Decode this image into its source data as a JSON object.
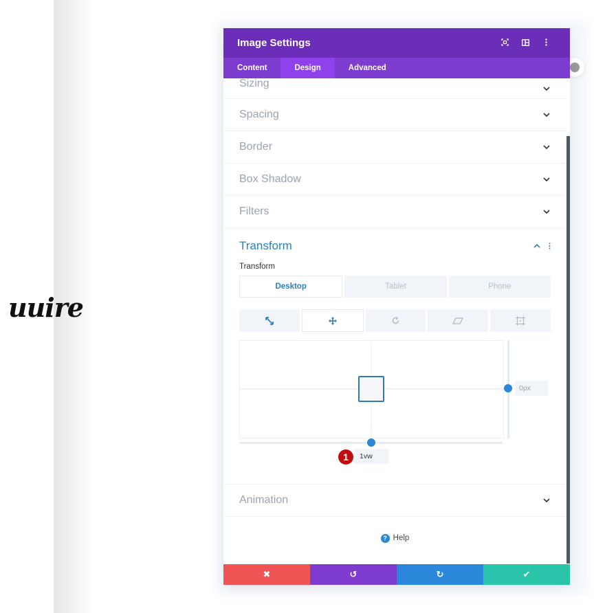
{
  "logo": {
    "text": "uuire"
  },
  "modal": {
    "title": "Image Settings",
    "header_icons": [
      "fullscreen-icon",
      "split-view-icon",
      "more-options-icon"
    ],
    "tabs": [
      {
        "label": "Content",
        "active": false
      },
      {
        "label": "Design",
        "active": true
      },
      {
        "label": "Advanced",
        "active": false
      }
    ],
    "sections": [
      {
        "label": "Sizing",
        "expanded": false
      },
      {
        "label": "Spacing",
        "expanded": false
      },
      {
        "label": "Border",
        "expanded": false
      },
      {
        "label": "Box Shadow",
        "expanded": false
      },
      {
        "label": "Filters",
        "expanded": false
      }
    ],
    "transform": {
      "label": "Transform",
      "sub_label": "Transform",
      "device_tabs": [
        {
          "label": "Desktop",
          "active": true
        },
        {
          "label": "Tablet",
          "active": false
        },
        {
          "label": "Phone",
          "active": false
        }
      ],
      "tool_tabs": [
        {
          "name": "scale",
          "active": false
        },
        {
          "name": "translate",
          "active": true
        },
        {
          "name": "rotate",
          "active": false
        },
        {
          "name": "skew",
          "active": false
        },
        {
          "name": "origin",
          "active": false
        }
      ],
      "translate_y_value": "0px",
      "translate_x_value": "1vw",
      "step_badge": "1"
    },
    "animation": {
      "label": "Animation"
    },
    "help": {
      "label": "Help"
    },
    "footer": {
      "buttons": [
        {
          "name": "cancel",
          "icon": "✖",
          "color": "#ef5555"
        },
        {
          "name": "undo",
          "icon": "↺",
          "color": "#7e3bd0"
        },
        {
          "name": "redo",
          "icon": "↻",
          "color": "#2b87da"
        },
        {
          "name": "save",
          "icon": "✔",
          "color": "#29c4a9"
        }
      ]
    }
  }
}
